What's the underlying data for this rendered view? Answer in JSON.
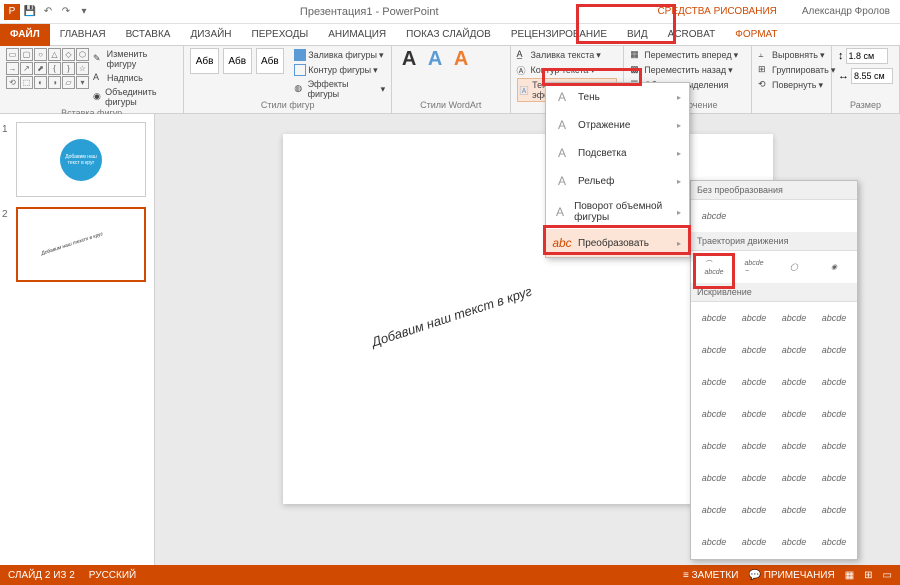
{
  "titlebar": {
    "title": "Презентация1 - PowerPoint",
    "context_tool": "СРЕДСТВА РИСОВАНИЯ",
    "user": "Александр Фролов"
  },
  "tabs": {
    "file": "ФАЙЛ",
    "items": [
      "ГЛАВНАЯ",
      "ВСТАВКА",
      "ДИЗАЙН",
      "ПЕРЕХОДЫ",
      "АНИМАЦИЯ",
      "ПОКАЗ СЛАЙДОВ",
      "РЕЦЕНЗИРОВАНИЕ",
      "ВИД",
      "ACROBAT"
    ],
    "format": "ФОРМАТ"
  },
  "ribbon": {
    "shapes_label": "Вставка фигур",
    "styles_label": "Стили фигур",
    "wordart_label": "Стили WordArt",
    "arrange_label": "Упорядочение",
    "size_label": "Размер",
    "edit_shape": "Изменить фигуру",
    "text_box": "Надпись",
    "merge": "Объединить фигуры",
    "style_prev": "Абв",
    "shape_fill": "Заливка фигуры",
    "shape_outline": "Контур фигуры",
    "shape_effects": "Эффекты фигуры",
    "text_fill": "Заливка текста",
    "text_outline": "Контур текста",
    "text_effects": "Текстовые эффекты",
    "bring_forward": "Переместить вперед",
    "send_backward": "Переместить назад",
    "selection_pane": "Область выделения",
    "align": "Выровнять",
    "group": "Группировать",
    "rotate": "Повернуть",
    "height": "1.8 см",
    "width": "8.55 см"
  },
  "dropdown": {
    "items": [
      {
        "label": "Тень",
        "arrow": true
      },
      {
        "label": "Отражение",
        "arrow": true
      },
      {
        "label": "Подсветка",
        "arrow": true
      },
      {
        "label": "Рельеф",
        "arrow": true
      },
      {
        "label": "Поворот объемной фигуры",
        "arrow": true
      },
      {
        "label": "Преобразовать",
        "arrow": true,
        "hover": true
      }
    ]
  },
  "transform": {
    "no_transform": "Без преобразования",
    "no_transform_sample": "abcde",
    "path": "Траектория движения",
    "warp": "Искривление",
    "sample": "abcde"
  },
  "slides": {
    "num1": "1",
    "num2": "2",
    "circle_text": "Добавим наш текст в круг"
  },
  "canvas": {
    "curved_text": "Добавим наш текст в круг"
  },
  "status": {
    "slide": "СЛАЙД 2 ИЗ 2",
    "lang": "РУССКИЙ",
    "notes": "ЗАМЕТКИ",
    "comments": "ПРИМЕЧАНИЯ"
  }
}
